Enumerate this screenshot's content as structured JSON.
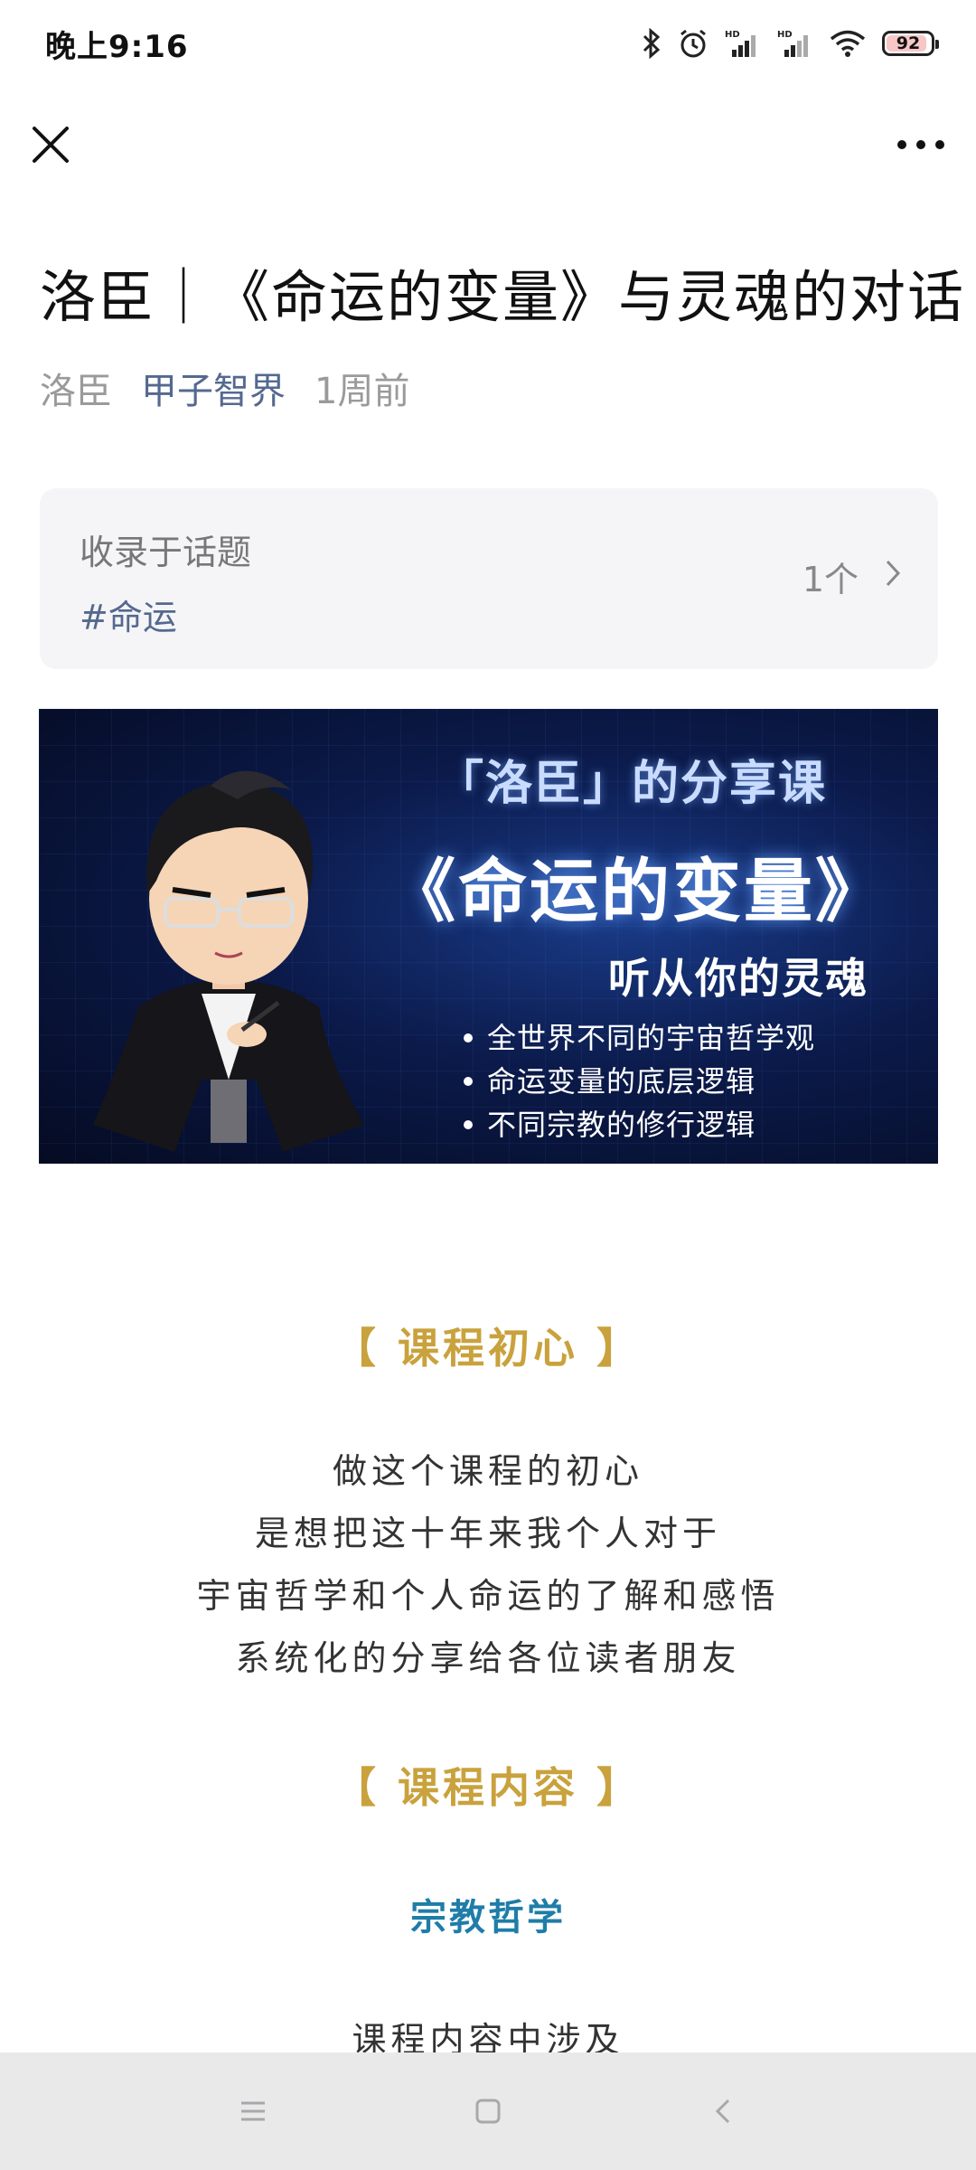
{
  "status_bar": {
    "time": "晚上9:16",
    "battery": "92",
    "battery_level": 0.92,
    "icons": [
      "bluetooth-icon",
      "alarm-icon",
      "signal-hd-icon",
      "signal-hd-icon",
      "wifi-icon",
      "battery-icon"
    ]
  },
  "nav": {
    "close_icon": "close-icon",
    "more_icon": "more-icon"
  },
  "article": {
    "title": "洛臣｜《命运的变量》与灵魂的对话",
    "author": "洛臣",
    "account": "甲子智界",
    "time": "1周前"
  },
  "topic": {
    "label": "收录于话题",
    "tag": "#命运",
    "count": "1个"
  },
  "banner": {
    "heading": "「洛臣」的分享课",
    "course": "《命运的变量》",
    "subtitle": "听从你的灵魂",
    "bullets": [
      "全世界不同的宇宙哲学观",
      "命运变量的底层逻辑",
      "不同宗教的修行逻辑"
    ]
  },
  "content": {
    "section1_heading": "【 课程初心 】",
    "section1_lines": [
      "做这个课程的初心",
      "是想把这十年来我个人对于",
      "宇宙哲学和个人命运的了解和感悟",
      "系统化的分享给各位读者朋友"
    ],
    "section2_heading": "【 课程内容 】",
    "sub_heading": "宗教哲学",
    "trail_text": "课程内容中涉及"
  },
  "colors": {
    "accent_gold": "#c9a23d",
    "accent_blue": "#1f7da8",
    "link_blue": "#55698f"
  }
}
